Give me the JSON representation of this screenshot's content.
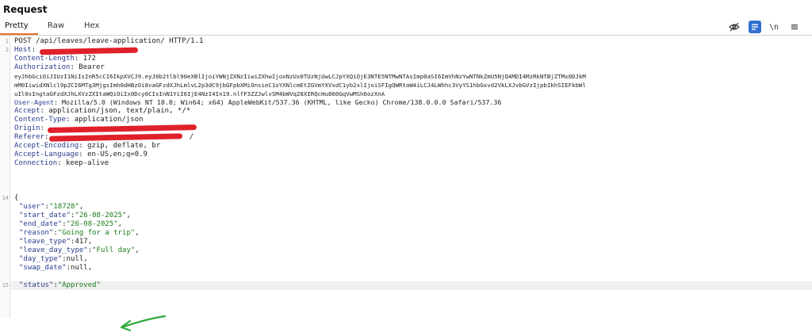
{
  "panel": {
    "title": "Request"
  },
  "tabs": [
    {
      "label": "Pretty",
      "active": true
    },
    {
      "label": "Raw",
      "active": false
    },
    {
      "label": "Hex",
      "active": false
    }
  ],
  "toolbar": {
    "newline_label": "\\n",
    "menu_glyph": "≡"
  },
  "request": {
    "request_line": "POST /api/leaves/leave-application/ HTTP/1.1",
    "headers": [
      {
        "name": "Host",
        "value": ""
      },
      {
        "name": "Content-Length",
        "value": " 172"
      },
      {
        "name": "Authorization",
        "value": " Bearer"
      },
      {
        "name": "User-Agent",
        "value": " Mozilla/5.0 (Windows NT 10.0; Win64; x64) AppleWebKit/537.36 (KHTML, like Gecko) Chrome/138.0.0.0 Safari/537.36"
      },
      {
        "name": "Accept",
        "value": " application/json, text/plain, */*"
      },
      {
        "name": "Content-Type",
        "value": " application/json"
      },
      {
        "name": "Origin",
        "value": ""
      },
      {
        "name": "Referer",
        "value": " /"
      },
      {
        "name": "Accept-Encoding",
        "value": " gzip, deflate, br"
      },
      {
        "name": "Accept-Language",
        "value": " en-US,en;q=0.9"
      },
      {
        "name": "Connection",
        "value": " keep-alive"
      }
    ],
    "token_lines": [
      "eyJhbGciOiJIUzI1NiIsInR5cCI6IkpXVCJ9.eyJ0b2tlbl90eXBlIjoiYWNjZXNzIiwiZXhwIjoxNzUx0TUzNjUwLCJpYXQiOjE3NTE5NTMwNTAsImp0aSI6ImVhNzYwNTNkZmU5NjQ4MDI4MzRkNTBjZTMx0DJkM",
      "mM0IiwidXNlcl9pZCI6MTg3MjgsImh0dHBzOi8vaGFzdXJhLmlvL2p3dC9jbGFpbXMiOnsieC1oYXNlcmEtZGVmYXVsdC1yb2xlIjoiSFIgQWRtaW4iLCJ4LWhhc3VyYS1hbGxvd2VkLXJvbGVzIjpbIkhSIEFkbWl",
      "uIl0sIngtaGFzdXJhLXVzZXItaWQiOiIx0Dcy0CIsInN1YiI6IjE4NzI4In19.nlfF3ZZJwlvSM4bWVq28XIRQcHu860GqVwMSh6ozXnA"
    ],
    "body_open": "{",
    "body": [
      {
        "key": "\"user\"",
        "value": "\"18728\"",
        "comma": ","
      },
      {
        "key": "\"start_date\"",
        "value": "\"26-08-2025\"",
        "comma": ","
      },
      {
        "key": "\"end_date\"",
        "value": "\"26-08-2025\"",
        "comma": ","
      },
      {
        "key": "\"reason\"",
        "value": "\"Going for a trip\"",
        "comma": ","
      },
      {
        "key": "\"leave_type\"",
        "value": "417",
        "comma": ","
      },
      {
        "key": "\"leave_day_type\"",
        "value": "\"Full day\"",
        "comma": ","
      },
      {
        "key": "\"day_type\"",
        "value": "null",
        "comma": ","
      },
      {
        "key": "\"swap_date\"",
        "value": "null",
        "comma": ","
      },
      {
        "key": "\"status\"",
        "value": "\"Approved\"",
        "comma": ""
      }
    ]
  },
  "gutter": {
    "first": "1",
    "second": "2",
    "body_start": "14",
    "last": "15"
  }
}
